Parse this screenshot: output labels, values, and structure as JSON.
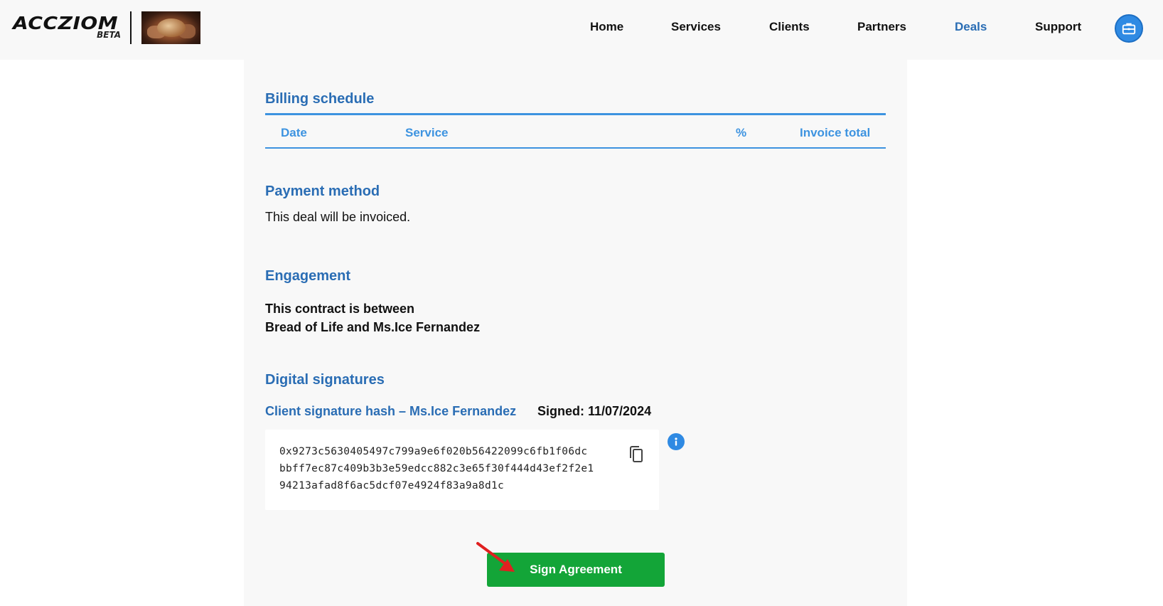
{
  "header": {
    "logo": {
      "brand": "ACCZIOM",
      "badge": "BETA"
    },
    "nav": [
      {
        "label": "Home",
        "active": false
      },
      {
        "label": "Services",
        "active": false
      },
      {
        "label": "Clients",
        "active": false
      },
      {
        "label": "Partners",
        "active": false
      },
      {
        "label": "Deals",
        "active": true
      },
      {
        "label": "Support",
        "active": false
      }
    ],
    "user_icon": "briefcase-icon"
  },
  "billing": {
    "title": "Billing schedule",
    "columns": [
      "Date",
      "Service",
      "%",
      "Invoice total"
    ],
    "rows": []
  },
  "payment": {
    "title": "Payment method",
    "text": "This deal will be invoiced."
  },
  "engagement": {
    "title": "Engagement",
    "line1": "This contract is between",
    "line2": "Bread of Life and Ms.Ice Fernandez"
  },
  "signatures": {
    "title": "Digital signatures",
    "client_label": "Client signature hash – Ms.Ice Fernandez",
    "signed": "Signed: 11/07/2024",
    "hash_lines": [
      "0x9273c5630405497c799a9e6f020b56422099c6fb1f06dc",
      "bbff7ec87c409b3b3e59edcc882c3e65f30f444d43ef2f2e1",
      "94213afad8f6ac5dcf07e4924f83a9a8d1c"
    ],
    "copy_icon": "copy-icon",
    "info_icon": "info-icon"
  },
  "actions": {
    "sign_label": "Sign Agreement"
  },
  "colors": {
    "accent": "#2a6db4",
    "table_accent": "#3d93e0",
    "sign_button": "#13a538",
    "annotation_arrow": "#e02020"
  }
}
